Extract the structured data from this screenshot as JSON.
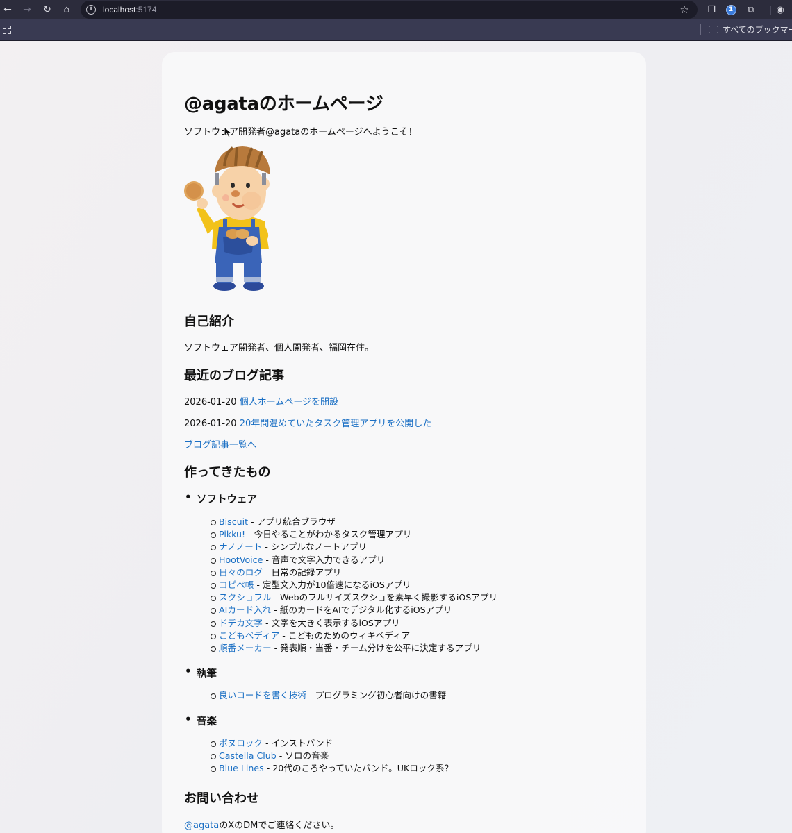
{
  "browser": {
    "url_host": "localhost",
    "url_port": ":5174",
    "bookmarks_folder": "すべてのブックマーク"
  },
  "page": {
    "title": "@agataのホームページ",
    "intro": "ソフトウェア開発者@agataのホームページへようこそ！",
    "about": {
      "heading": "自己紹介",
      "text": "ソフトウェア開発者、個人開発者、福岡在住。"
    },
    "blog": {
      "heading": "最近のブログ記事",
      "posts": [
        {
          "date": "2026-01-20",
          "title": "個人ホームページを開設"
        },
        {
          "date": "2026-01-20",
          "title": "20年間温めていたタスク管理アプリを公開した"
        }
      ],
      "all_link": "ブログ記事一覧へ"
    },
    "works": {
      "heading": "作ってきたもの",
      "categories": [
        {
          "name": "ソフトウェア",
          "items": [
            {
              "link": "Biscuit",
              "desc": " - アプリ統合ブラウザ"
            },
            {
              "link": "Pikku!",
              "desc": " - 今日やることがわかるタスク管理アプリ"
            },
            {
              "link": "ナノノート",
              "desc": " - シンプルなノートアプリ"
            },
            {
              "link": "HootVoice",
              "desc": " - 音声で文字入力できるアプリ"
            },
            {
              "link": "日々のログ",
              "desc": " - 日常の記録アプリ"
            },
            {
              "link": "コピペ帳",
              "desc": " - 定型文入力が10倍速になるiOSアプリ"
            },
            {
              "link": "スクショフル",
              "desc": " - Webのフルサイズスクショを素早く撮影するiOSアプリ"
            },
            {
              "link": "AIカード入れ",
              "desc": " - 紙のカードをAIでデジタル化するiOSアプリ"
            },
            {
              "link": "ドデカ文字",
              "desc": " - 文字を大きく表示するiOSアプリ"
            },
            {
              "link": "こどもペディア",
              "desc": " - こどものためのウィキペディア"
            },
            {
              "link": "順番メーカー",
              "desc": " - 発表順・当番・チーム分けを公平に決定するアプリ"
            }
          ]
        },
        {
          "name": "執筆",
          "items": [
            {
              "link": "良いコードを書く技術",
              "desc": " - プログラミング初心者向けの書籍"
            }
          ]
        },
        {
          "name": "音楽",
          "items": [
            {
              "link": "ポヌロック",
              "desc": " - インストバンド"
            },
            {
              "link": "Castella Club",
              "desc": " - ソロの音楽"
            },
            {
              "link": "Blue Lines",
              "desc": " - 20代のころやっていたバンド。UKロック系？"
            }
          ]
        }
      ]
    },
    "contact": {
      "heading": "お問い合わせ",
      "link": "@agata",
      "text": "のXのDMでご連絡ください。"
    }
  },
  "colors": {
    "link": "#1a6fc4",
    "chrome_bg": "#2c2c3c",
    "bookmark_bar_bg": "#393a52"
  }
}
